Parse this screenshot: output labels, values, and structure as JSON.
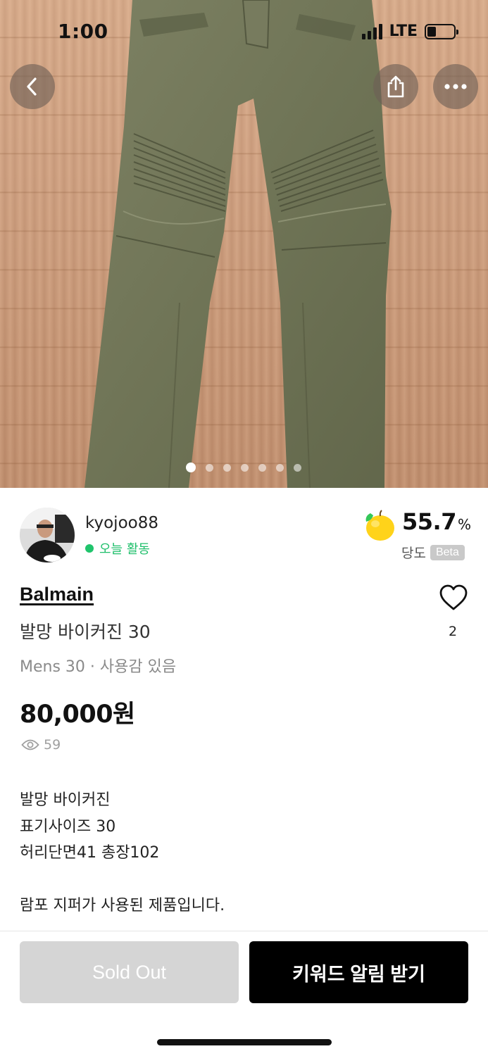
{
  "status_bar": {
    "time": "1:00",
    "network": "LTE",
    "battery_level": 0.3
  },
  "nav": {
    "back_icon": "chevron-left-icon",
    "share_icon": "share-icon",
    "more_icon": "more-horizontal-icon"
  },
  "gallery": {
    "total_images": 7,
    "current_index": 1
  },
  "seller": {
    "name": "kyojoo88",
    "activity": "오늘 활동",
    "activity_color": "#20c46c"
  },
  "sweetness": {
    "value": "55.7",
    "unit": "%",
    "label": "당도",
    "badge": "Beta"
  },
  "product": {
    "brand": "Balmain",
    "title": "발망 바이커진 30",
    "subinfo": "Mens 30 · 사용감 있음",
    "price": "80,000원",
    "views": "59",
    "likes": "2",
    "description": [
      "발망 바이커진",
      "표기사이즈 30",
      "허리단면41 총장102",
      "",
      "람포 지퍼가 사용된 제품입니다."
    ]
  },
  "actions": {
    "sold_out_label": "Sold Out",
    "alert_label": "키워드 알림 받기"
  },
  "colors": {
    "accent": "#000000",
    "active_green": "#20c46c",
    "disabled": "#d5d5d5"
  }
}
